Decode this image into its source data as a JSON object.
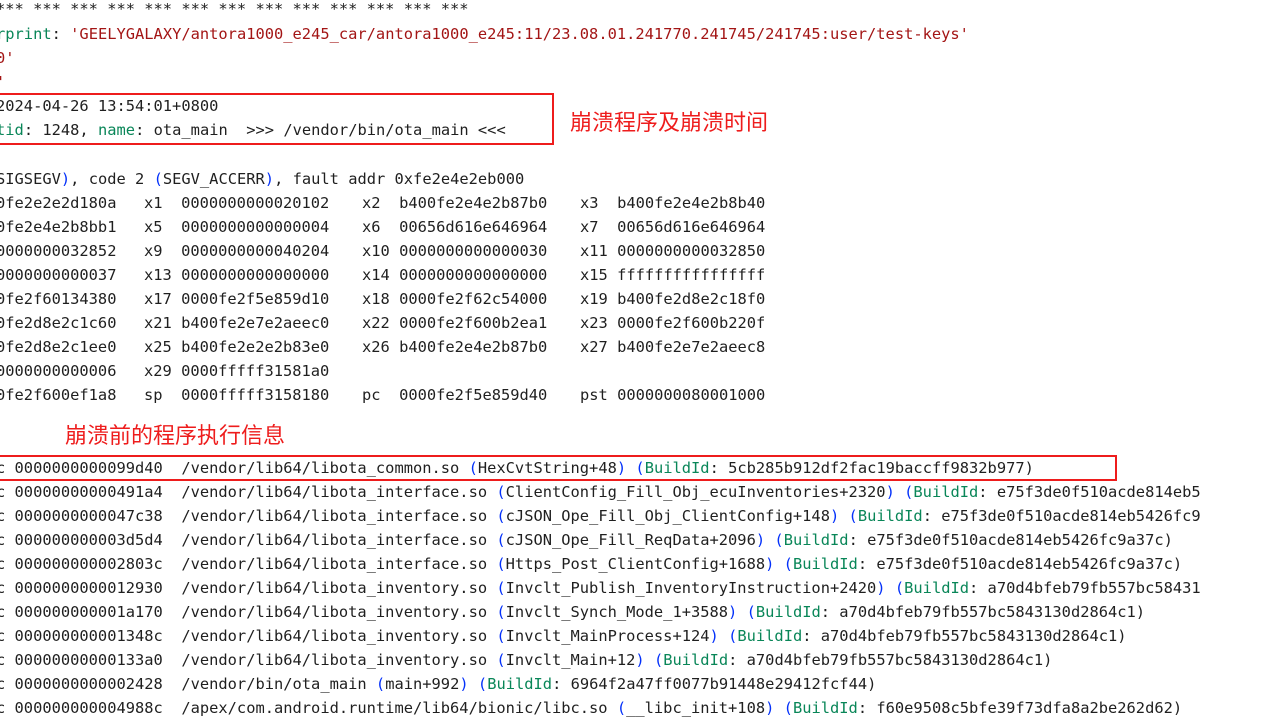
{
  "header": {
    "stars": "*** *** *** *** *** *** *** *** *** *** *** *** ***",
    "fp_key": "rprint",
    "fp_value": "'GEELYGALAXY/antora1000_e245_car/antora1000_e245:11/23.08.01.241770.241745/241745:user/test-keys'",
    "rev_line": "0'",
    "quote_line": "'"
  },
  "crash_info": {
    "timestamp": "2024-04-26 13:54:01+0800",
    "tid_key": "tid",
    "tid_value": "1248,",
    "name_key": "name",
    "name_value": "ota_main  >>> /vendor/bin/ota_main <<<"
  },
  "annotations": {
    "crash_label": "崩溃程序及崩溃时间",
    "trace_label": "崩溃前的程序执行信息"
  },
  "signal": {
    "sig": "SIGSEGV",
    "code_text": ", code 2 ",
    "code_name": "SEGV_ACCERR",
    "fault_text": ", fault addr 0xfe2e4e2eb000"
  },
  "registers": [
    [
      [
        "",
        "0fe2e2e2d180a"
      ],
      [
        "x1",
        "0000000000020102"
      ],
      [
        "x2",
        "b400fe2e4e2b87b0"
      ],
      [
        "x3",
        "b400fe2e4e2b8b40"
      ]
    ],
    [
      [
        "",
        "0fe2e4e2b8bb1"
      ],
      [
        "x5",
        "0000000000000004"
      ],
      [
        "x6",
        "00656d616e646964"
      ],
      [
        "x7",
        "00656d616e646964"
      ]
    ],
    [
      [
        "",
        "0000000032852"
      ],
      [
        "x9",
        "0000000000040204"
      ],
      [
        "x10",
        "0000000000000030"
      ],
      [
        "x11",
        "0000000000032850"
      ]
    ],
    [
      [
        "",
        "0000000000037"
      ],
      [
        "x13",
        "0000000000000000"
      ],
      [
        "x14",
        "0000000000000000"
      ],
      [
        "x15",
        "ffffffffffffffff"
      ]
    ],
    [
      [
        "",
        "0fe2f60134380"
      ],
      [
        "x17",
        "0000fe2f5e859d10"
      ],
      [
        "x18",
        "0000fe2f62c54000"
      ],
      [
        "x19",
        "b400fe2d8e2c18f0"
      ]
    ],
    [
      [
        "",
        "0fe2d8e2c1c60"
      ],
      [
        "x21",
        "b400fe2e7e2aeec0"
      ],
      [
        "x22",
        "0000fe2f600b2ea1"
      ],
      [
        "x23",
        "0000fe2f600b220f"
      ]
    ],
    [
      [
        "",
        "0fe2d8e2c1ee0"
      ],
      [
        "x25",
        "b400fe2e2e2b83e0"
      ],
      [
        "x26",
        "b400fe2e4e2b87b0"
      ],
      [
        "x27",
        "b400fe2e7e2aeec8"
      ]
    ],
    [
      [
        "",
        "0000000000006"
      ],
      [
        "x29",
        "0000fffff31581a0"
      ]
    ],
    [
      [
        "",
        "0fe2f600ef1a8"
      ],
      [
        "sp",
        "0000fffff3158180"
      ],
      [
        "pc",
        "0000fe2f5e859d40"
      ],
      [
        "pst",
        "0000000080001000"
      ]
    ]
  ],
  "backtrace": [
    {
      "pc": "c 0000000000099d40",
      "path": "/vendor/lib64/libota_common.so",
      "fn": "HexCvtString+48",
      "bid_key": "BuildId",
      "bid": "5cb285b912df2fac19baccff9832b977)"
    },
    {
      "pc": "c 00000000000491a4",
      "path": "/vendor/lib64/libota_interface.so",
      "fn": "ClientConfig_Fill_Obj_ecuInventories+2320",
      "bid_key": "BuildId",
      "bid": "e75f3de0f510acde814eb5"
    },
    {
      "pc": "c 0000000000047c38",
      "path": "/vendor/lib64/libota_interface.so",
      "fn": "cJSON_Ope_Fill_Obj_ClientConfig+148",
      "bid_key": "BuildId",
      "bid": "e75f3de0f510acde814eb5426fc9"
    },
    {
      "pc": "c 000000000003d5d4",
      "path": "/vendor/lib64/libota_interface.so",
      "fn": "cJSON_Ope_Fill_ReqData+2096",
      "bid_key": "BuildId",
      "bid": "e75f3de0f510acde814eb5426fc9a37c)"
    },
    {
      "pc": "c 000000000002803c",
      "path": "/vendor/lib64/libota_interface.so",
      "fn": "Https_Post_ClientConfig+1688",
      "bid_key": "BuildId",
      "bid": "e75f3de0f510acde814eb5426fc9a37c)"
    },
    {
      "pc": "c 0000000000012930",
      "path": "/vendor/lib64/libota_inventory.so",
      "fn": "Invclt_Publish_InventoryInstruction+2420",
      "bid_key": "BuildId",
      "bid": "a70d4bfeb79fb557bc58431"
    },
    {
      "pc": "c 000000000001a170",
      "path": "/vendor/lib64/libota_inventory.so",
      "fn": "Invclt_Synch_Mode_1+3588",
      "bid_key": "BuildId",
      "bid": "a70d4bfeb79fb557bc5843130d2864c1)"
    },
    {
      "pc": "c 000000000001348c",
      "path": "/vendor/lib64/libota_inventory.so",
      "fn": "Invclt_MainProcess+124",
      "bid_key": "BuildId",
      "bid": "a70d4bfeb79fb557bc5843130d2864c1)"
    },
    {
      "pc": "c 00000000000133a0",
      "path": "/vendor/lib64/libota_inventory.so",
      "fn": "Invclt_Main+12",
      "bid_key": "BuildId",
      "bid": "a70d4bfeb79fb557bc5843130d2864c1)"
    },
    {
      "pc": "c 0000000000002428",
      "path": "/vendor/bin/ota_main",
      "fn": "main+992",
      "bid_key": "BuildId",
      "bid": "6964f2a47ff0077b91448e29412fcf44)"
    },
    {
      "pc": "c 000000000004988c",
      "path": "/apex/com.android.runtime/lib64/bionic/libc.so",
      "fn": "__libc_init+108",
      "bid_key": "BuildId",
      "bid": "f60e9508c5bfe39f73dfa8a2be262d62)"
    }
  ]
}
